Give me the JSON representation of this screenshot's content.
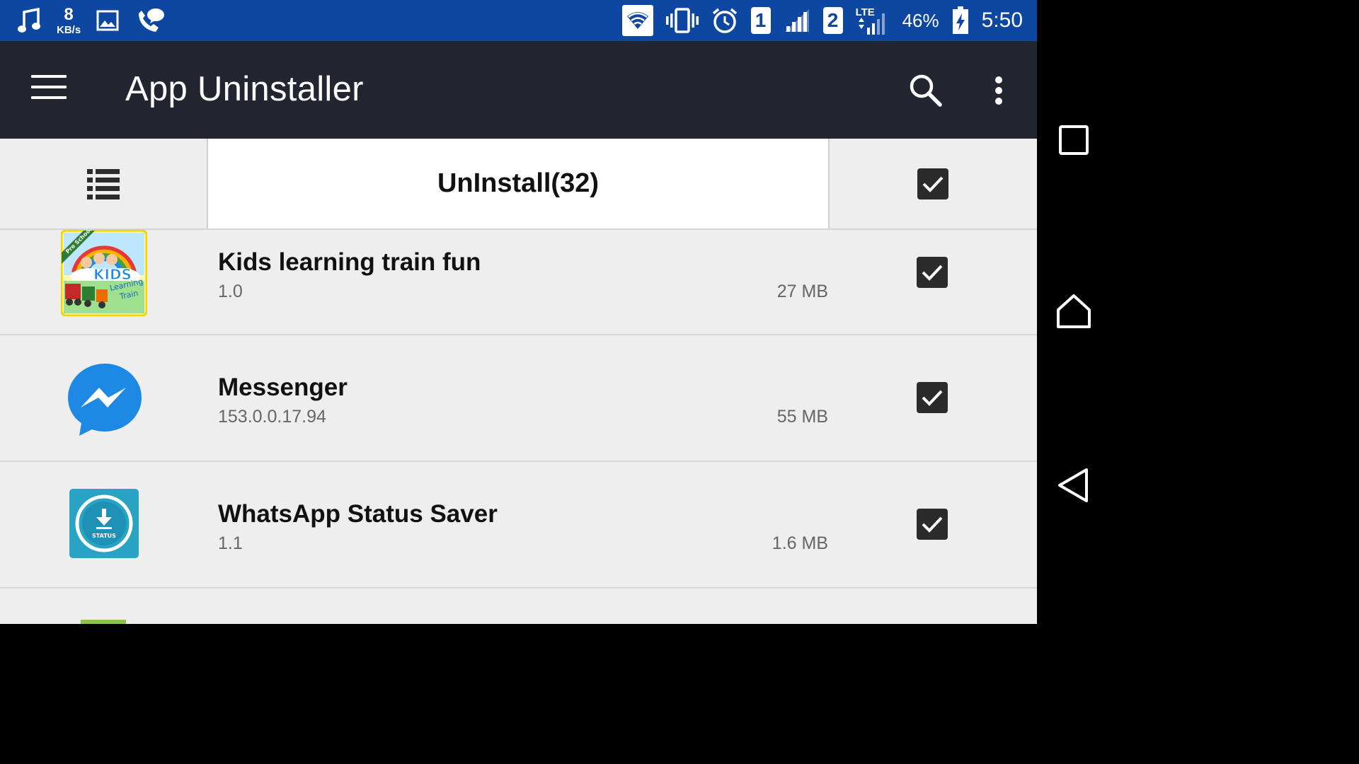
{
  "status_bar": {
    "net_speed_value": "8",
    "net_speed_unit": "KB/s",
    "sim1": "1",
    "sim2": "2",
    "network_type": "LTE",
    "battery": "46%",
    "time": "5:50",
    "icons": [
      "music-icon",
      "image-icon",
      "call-icon",
      "wifi-icon",
      "vibrate-icon",
      "alarm-icon",
      "signal-icon",
      "battery-icon"
    ]
  },
  "toolbar": {
    "title": "App Uninstaller",
    "icons": [
      "menu-icon",
      "search-icon",
      "more-vert-icon"
    ]
  },
  "action_bar": {
    "uninstall_label": "UnInstall(32)",
    "select_all_checked": true
  },
  "apps": [
    {
      "name": "Kids learning train fun",
      "version": "1.0",
      "size": "27 MB",
      "checked": true
    },
    {
      "name": "Messenger",
      "version": "153.0.0.17.94",
      "size": "55 MB",
      "checked": true
    },
    {
      "name": "WhatsApp Status Saver",
      "version": "1.1",
      "size": "1.6 MB",
      "checked": true
    }
  ],
  "app_icon_text": {
    "kids_banner": "Pre School",
    "kids_word": "KIDS",
    "kids_sub1": "Learning",
    "kids_sub2": "Train",
    "status_word": "STATUS"
  },
  "colors": {
    "status_bar": "#0d47a1",
    "toolbar": "#212630",
    "list_bg": "#eeeeee",
    "checkbox": "#2b2b2b",
    "messenger": "#1e88e5",
    "status_saver": "#29a3c3"
  }
}
